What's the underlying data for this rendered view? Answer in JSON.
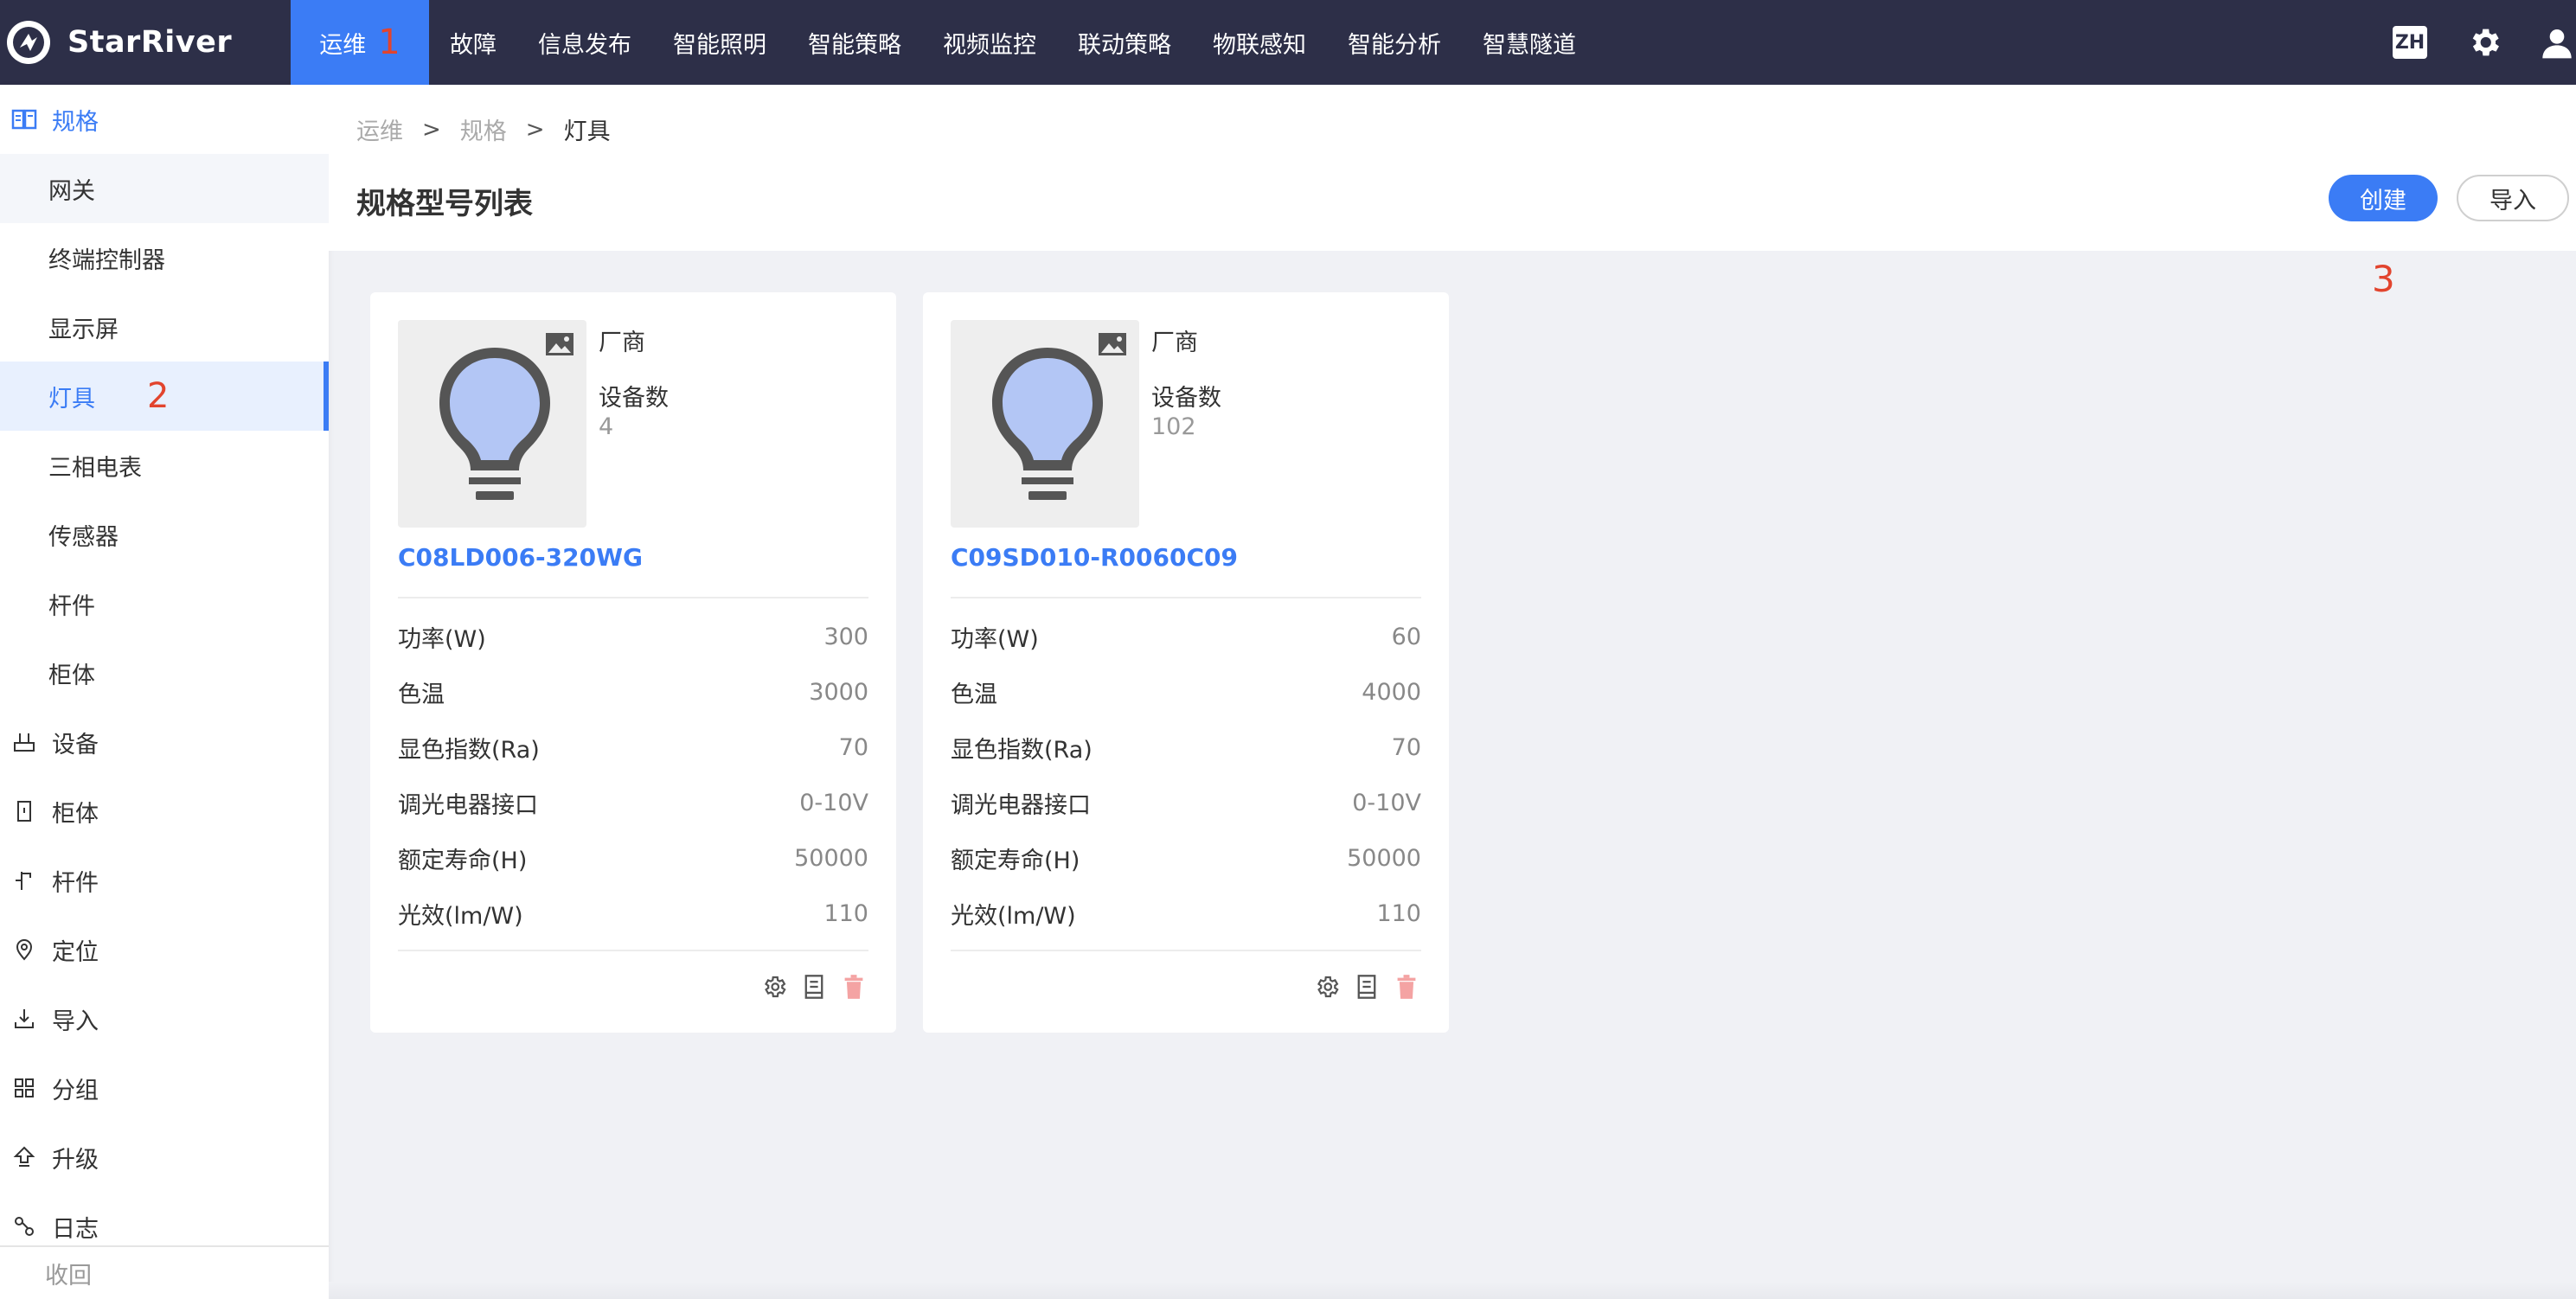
{
  "app": {
    "name": "StarRiver"
  },
  "nav": {
    "items": [
      {
        "label": "运维",
        "badge": "1",
        "active": true
      },
      {
        "label": "故障"
      },
      {
        "label": "信息发布"
      },
      {
        "label": "智能照明"
      },
      {
        "label": "智能策略"
      },
      {
        "label": "视频监控"
      },
      {
        "label": "联动策略"
      },
      {
        "label": "物联感知"
      },
      {
        "label": "智能分析"
      },
      {
        "label": "智慧隧道"
      }
    ],
    "lang": "ZH",
    "right_icons": [
      "gear-icon",
      "user-icon"
    ]
  },
  "sidebar": {
    "group": {
      "label": "规格",
      "icon": "book-icon"
    },
    "sub_items": [
      {
        "label": "网关"
      },
      {
        "label": "终端控制器"
      },
      {
        "label": "显示屏"
      },
      {
        "label": "灯具",
        "badge": "2",
        "selected": true
      },
      {
        "label": "三相电表"
      },
      {
        "label": "传感器"
      },
      {
        "label": "杆件"
      },
      {
        "label": "柜体"
      }
    ],
    "items": [
      {
        "label": "设备",
        "icon": "device-icon"
      },
      {
        "label": "柜体",
        "icon": "cabinet-icon"
      },
      {
        "label": "杆件",
        "icon": "pole-icon"
      },
      {
        "label": "定位",
        "icon": "location-icon"
      },
      {
        "label": "导入",
        "icon": "import-icon"
      },
      {
        "label": "分组",
        "icon": "grid-icon"
      },
      {
        "label": "升级",
        "icon": "upgrade-icon"
      },
      {
        "label": "日志",
        "icon": "log-icon"
      }
    ],
    "collapse_label": "收回"
  },
  "breadcrumb": [
    "运维",
    "规格",
    "灯具"
  ],
  "page": {
    "title": "规格型号列表",
    "create_label": "创建",
    "import_label": "导入",
    "step_marker": "3"
  },
  "cards": [
    {
      "vendor_label": "厂商",
      "count_label": "设备数",
      "count": "4",
      "model": "C08LD006-320WG",
      "specs": [
        {
          "k": "功率(W)",
          "v": "300"
        },
        {
          "k": "色温",
          "v": "3000"
        },
        {
          "k": "显色指数(Ra)",
          "v": "70"
        },
        {
          "k": "调光电器接口",
          "v": "0-10V"
        },
        {
          "k": "额定寿命(H)",
          "v": "50000"
        },
        {
          "k": "光效(lm/W)",
          "v": "110"
        }
      ]
    },
    {
      "vendor_label": "厂商",
      "count_label": "设备数",
      "count": "102",
      "model": "C09SD010-R0060C09",
      "specs": [
        {
          "k": "功率(W)",
          "v": "60"
        },
        {
          "k": "色温",
          "v": "4000"
        },
        {
          "k": "显色指数(Ra)",
          "v": "70"
        },
        {
          "k": "调光电器接口",
          "v": "0-10V"
        },
        {
          "k": "额定寿命(H)",
          "v": "50000"
        },
        {
          "k": "光效(lm/W)",
          "v": "110"
        }
      ]
    }
  ],
  "colors": {
    "topbar": "#2d2f48",
    "accent": "#3b7cf5",
    "marker": "#e2442e",
    "delete": "#f4a3a3"
  }
}
